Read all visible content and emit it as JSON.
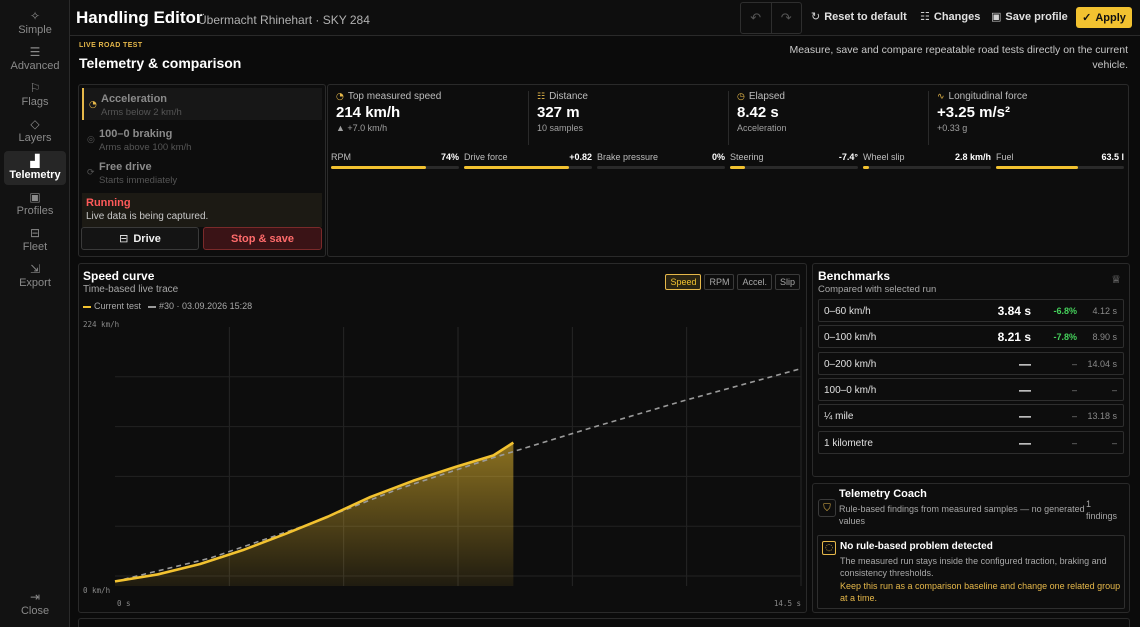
{
  "sidebar": {
    "items": [
      {
        "id": "simple",
        "label": "Simple",
        "icon": "sparkle-icon",
        "glyph": "✧"
      },
      {
        "id": "advanced",
        "label": "Advanced",
        "icon": "sliders-icon",
        "glyph": "☰"
      },
      {
        "id": "flags",
        "label": "Flags",
        "icon": "flag-icon",
        "glyph": "⚐"
      },
      {
        "id": "layers",
        "label": "Layers",
        "icon": "layers-icon",
        "glyph": "◇"
      },
      {
        "id": "telemetry",
        "label": "Telemetry",
        "icon": "chart-icon",
        "glyph": "▟"
      },
      {
        "id": "profiles",
        "label": "Profiles",
        "icon": "save-icon",
        "glyph": "▣"
      },
      {
        "id": "fleet",
        "label": "Fleet",
        "icon": "car-icon",
        "glyph": "⊟"
      },
      {
        "id": "export",
        "label": "Export",
        "icon": "export-icon",
        "glyph": "⇲"
      }
    ],
    "active": "telemetry",
    "close_label": "Close",
    "close_glyph": "⇥"
  },
  "header": {
    "title": "Handling Editor",
    "subtitle": "Übermacht Rhinehart · SKY 284",
    "undo_glyph": "↶",
    "redo_glyph": "↷",
    "reset_label": "Reset to default",
    "reset_glyph": "↻",
    "changes_label": "Changes",
    "changes_glyph": "☷",
    "save_label": "Save profile",
    "save_glyph": "▣",
    "apply_label": "Apply",
    "apply_glyph": "✓"
  },
  "section": {
    "kicker": "LIVE ROAD TEST",
    "title": "Telemetry & comparison",
    "description": "Measure, save and compare repeatable road tests directly on the current vehicle."
  },
  "test": {
    "modes": [
      {
        "title": "Acceleration",
        "subtitle": "Arms below 2 km/h",
        "glyph": "◔",
        "active": true
      },
      {
        "title": "100–0 braking",
        "subtitle": "Arms above 100 km/h",
        "glyph": "◎",
        "active": false
      },
      {
        "title": "Free drive",
        "subtitle": "Starts immediately",
        "glyph": "⟳",
        "active": false
      }
    ],
    "status_title": "Running",
    "status_text": "Live data is being captured.",
    "drive_label": "Drive",
    "drive_glyph": "⊟",
    "stop_label": "Stop & save"
  },
  "metrics": [
    {
      "label": "Top measured speed",
      "value": "214 km/h",
      "sub": "▲ +7.0 km/h",
      "glyph": "◔"
    },
    {
      "label": "Distance",
      "value": "327 m",
      "sub": "10 samples",
      "glyph": "☷"
    },
    {
      "label": "Elapsed",
      "value": "8.42 s",
      "sub": "Acceleration",
      "glyph": "◷"
    },
    {
      "label": "Longitudinal force",
      "value": "+3.25 m/s²",
      "sub": "+0.33 g",
      "glyph": "∿"
    }
  ],
  "gauges": [
    {
      "label": "RPM",
      "value": "74%",
      "level": 0.74
    },
    {
      "label": "Drive force",
      "value": "+0.82",
      "level": 0.82
    },
    {
      "label": "Brake pressure",
      "value": "0%",
      "level": 0
    },
    {
      "label": "Steering",
      "value": "-7.4°",
      "level": 0.12
    },
    {
      "label": "Wheel slip",
      "value": "2.8 km/h",
      "level": 0.05
    },
    {
      "label": "Fuel",
      "value": "63.5 l",
      "level": 0.64
    }
  ],
  "curve": {
    "title": "Speed curve",
    "subtitle": "Time-based live trace",
    "tabs": [
      {
        "label": "Speed",
        "active": true
      },
      {
        "label": "RPM",
        "active": false
      },
      {
        "label": "Accel.",
        "active": false
      },
      {
        "label": "Slip",
        "active": false
      }
    ],
    "legend_current": "Current test",
    "legend_reference": "#30 · 03.09.2026 15:28",
    "current_color": "#f2c230",
    "reference_color": "#9a9a9a"
  },
  "chart_data": {
    "type": "area",
    "xlabel_min": "0 s",
    "xlabel_max": "14.5 s",
    "ylabel_min": "0 km/h",
    "ylabel_max": "224 km/h",
    "xlim": [
      0,
      14.5
    ],
    "ylim": [
      0,
      224
    ],
    "grid": true,
    "series": [
      {
        "name": "Current test",
        "style": "solid-area",
        "x": [
          0,
          0.9,
          1.8,
          2.7,
          3.6,
          4.5,
          5.4,
          6.3,
          7.2,
          8.0,
          8.42
        ],
        "y": [
          4,
          10,
          19,
          31,
          45,
          60,
          77,
          91,
          103,
          113,
          124
        ]
      },
      {
        "name": "#30 · 03.09.2026 15:28",
        "style": "dashed",
        "x": [
          0,
          2,
          4,
          6,
          8,
          10,
          12,
          14.5
        ],
        "y": [
          4,
          24,
          52,
          84,
          111,
          136,
          160,
          188
        ]
      }
    ]
  },
  "benchmarks": {
    "title": "Benchmarks",
    "subtitle": "Compared with selected run",
    "trophy_glyph": "♕",
    "rows": [
      {
        "name": "0–60 km/h",
        "value": "3.84 s",
        "delta": "-6.8%",
        "ref": "4.12 s",
        "good": true
      },
      {
        "name": "0–100 km/h",
        "value": "8.21 s",
        "delta": "-7.8%",
        "ref": "8.90 s",
        "good": true
      },
      {
        "name": "0–200 km/h",
        "value": "—",
        "delta": "–",
        "ref": "14.04 s",
        "good": false
      },
      {
        "name": "100–0 km/h",
        "value": "—",
        "delta": "–",
        "ref": "–",
        "good": false
      },
      {
        "name": "¼ mile",
        "value": "—",
        "delta": "–",
        "ref": "13.18 s",
        "good": false
      },
      {
        "name": "1 kilometre",
        "value": "—",
        "delta": "–",
        "ref": "–",
        "good": false
      }
    ]
  },
  "coach": {
    "title": "Telemetry Coach",
    "subtitle": "Rule-based findings from measured samples — no generated values",
    "count": "1 findings",
    "glyph": "⛉",
    "finding_glyph": "◌",
    "finding_title": "No rule-based problem detected",
    "finding_text": "The measured run stays inside the configured traction, braking and consistency thresholds.",
    "finding_advice": "Keep this run as a comparison baseline and change one related group at a time."
  }
}
